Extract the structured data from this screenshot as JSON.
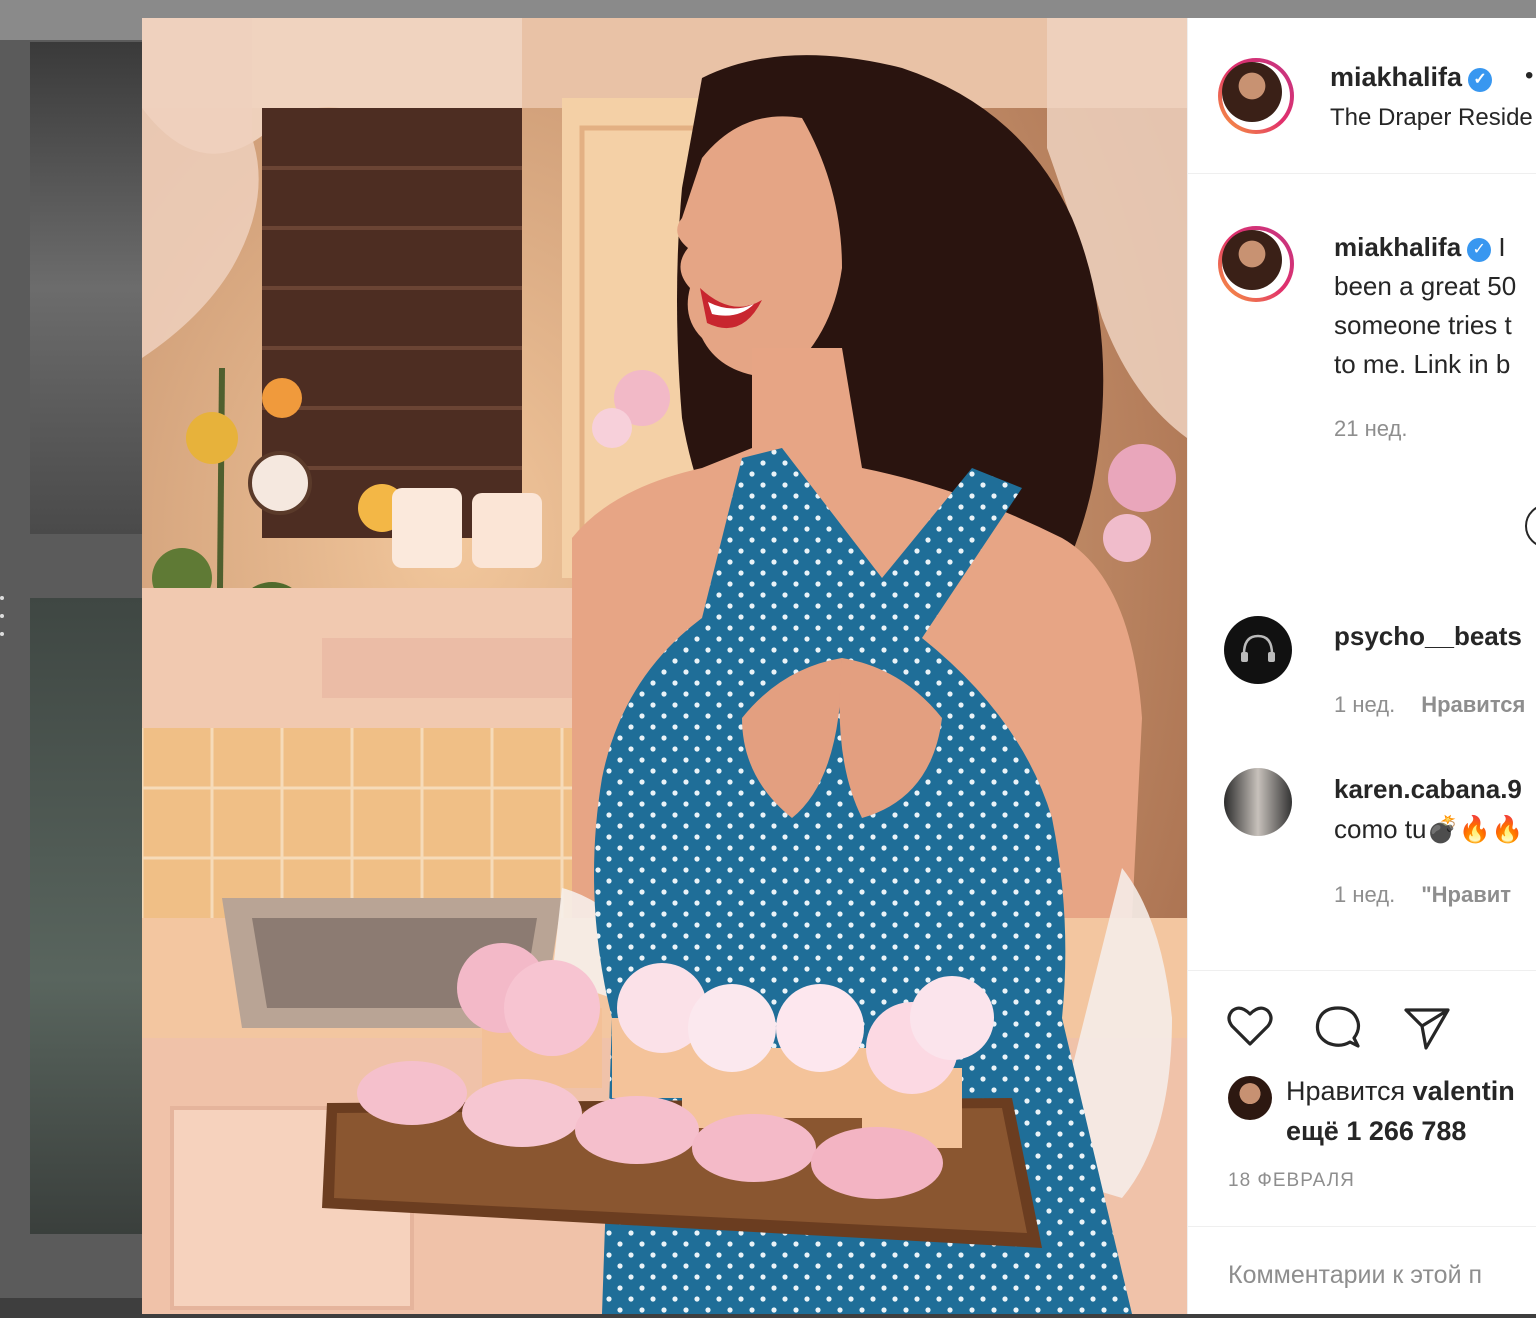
{
  "post": {
    "author": "miakhalifa",
    "separator": "•",
    "location": "The Draper Reside",
    "caption_user": "miakhalifa",
    "caption_lines": [
      "I",
      "been a great 50",
      "someone tries t",
      "to me. Link in b"
    ],
    "caption_time": "21 нед.",
    "likes_prefix": "Нравится",
    "likes_user": "valentin",
    "likes_more": "ещё 1 266 788",
    "date": "18 ФЕВРАЛЯ",
    "comment_placeholder": "Комментарии к этой п"
  },
  "comments": [
    {
      "user": "psycho__beats",
      "text": "",
      "time": "1 нед.",
      "action": "Нравится"
    },
    {
      "user": "karen.cabana.9",
      "text": "como tu💣🔥🔥",
      "time": "1 нед.",
      "action": "\"Нравит"
    }
  ],
  "icons": {
    "like": "heart-icon",
    "comment": "comment-bubble-icon",
    "share": "paper-plane-icon",
    "verified": "verified-badge-icon"
  },
  "colors": {
    "verified": "#3897f0",
    "story_ring_start": "#f9a13b",
    "story_ring_end": "#c13584",
    "secondary_text": "#8e8e8e"
  }
}
